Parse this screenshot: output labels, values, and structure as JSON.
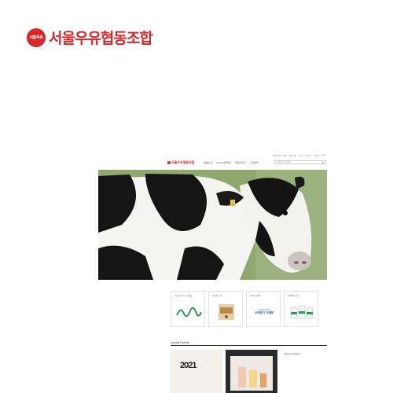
{
  "brand": {
    "mark_text": "서울우유",
    "name": "서울우유협동조합",
    "color": "#d7262c"
  },
  "site": {
    "logo_text": "서울우유협동조합",
    "nav": [
      "제품소개",
      "About서울우유",
      "우유이야기",
      "고객센터"
    ],
    "utility": [
      "서울우유 공식 쇼핑몰",
      "서울우유몰",
      "로그인",
      "회원가입",
      "사이트맵",
      "ENG"
    ],
    "search_placeholder": "검색어를 입력하세요",
    "cards": [
      {
        "caption": "서울우유 공식 쇼핑몰",
        "art": "script-logo"
      },
      {
        "caption": "신제품 소식",
        "art": "product-box"
      },
      {
        "caption": "온라인 이벤트",
        "art": "event-banner",
        "event_text": "구매후기 이벤트",
        "event_top": "나 100% 믿어"
      },
      {
        "caption": "카페메뉴 추천",
        "art": "milk-cartons"
      }
    ],
    "social_title": "Social Center",
    "social": [
      {
        "type": "light",
        "year": "2021",
        "badge": ""
      },
      {
        "type": "dark",
        "badge": ""
      },
      {
        "type": "plain",
        "note": "서울우유 Instagram",
        "badge": ""
      }
    ]
  },
  "colors": {
    "accent": "#d7262c",
    "grass": "#8ea86e",
    "event_blue": "#1f5fa8"
  }
}
